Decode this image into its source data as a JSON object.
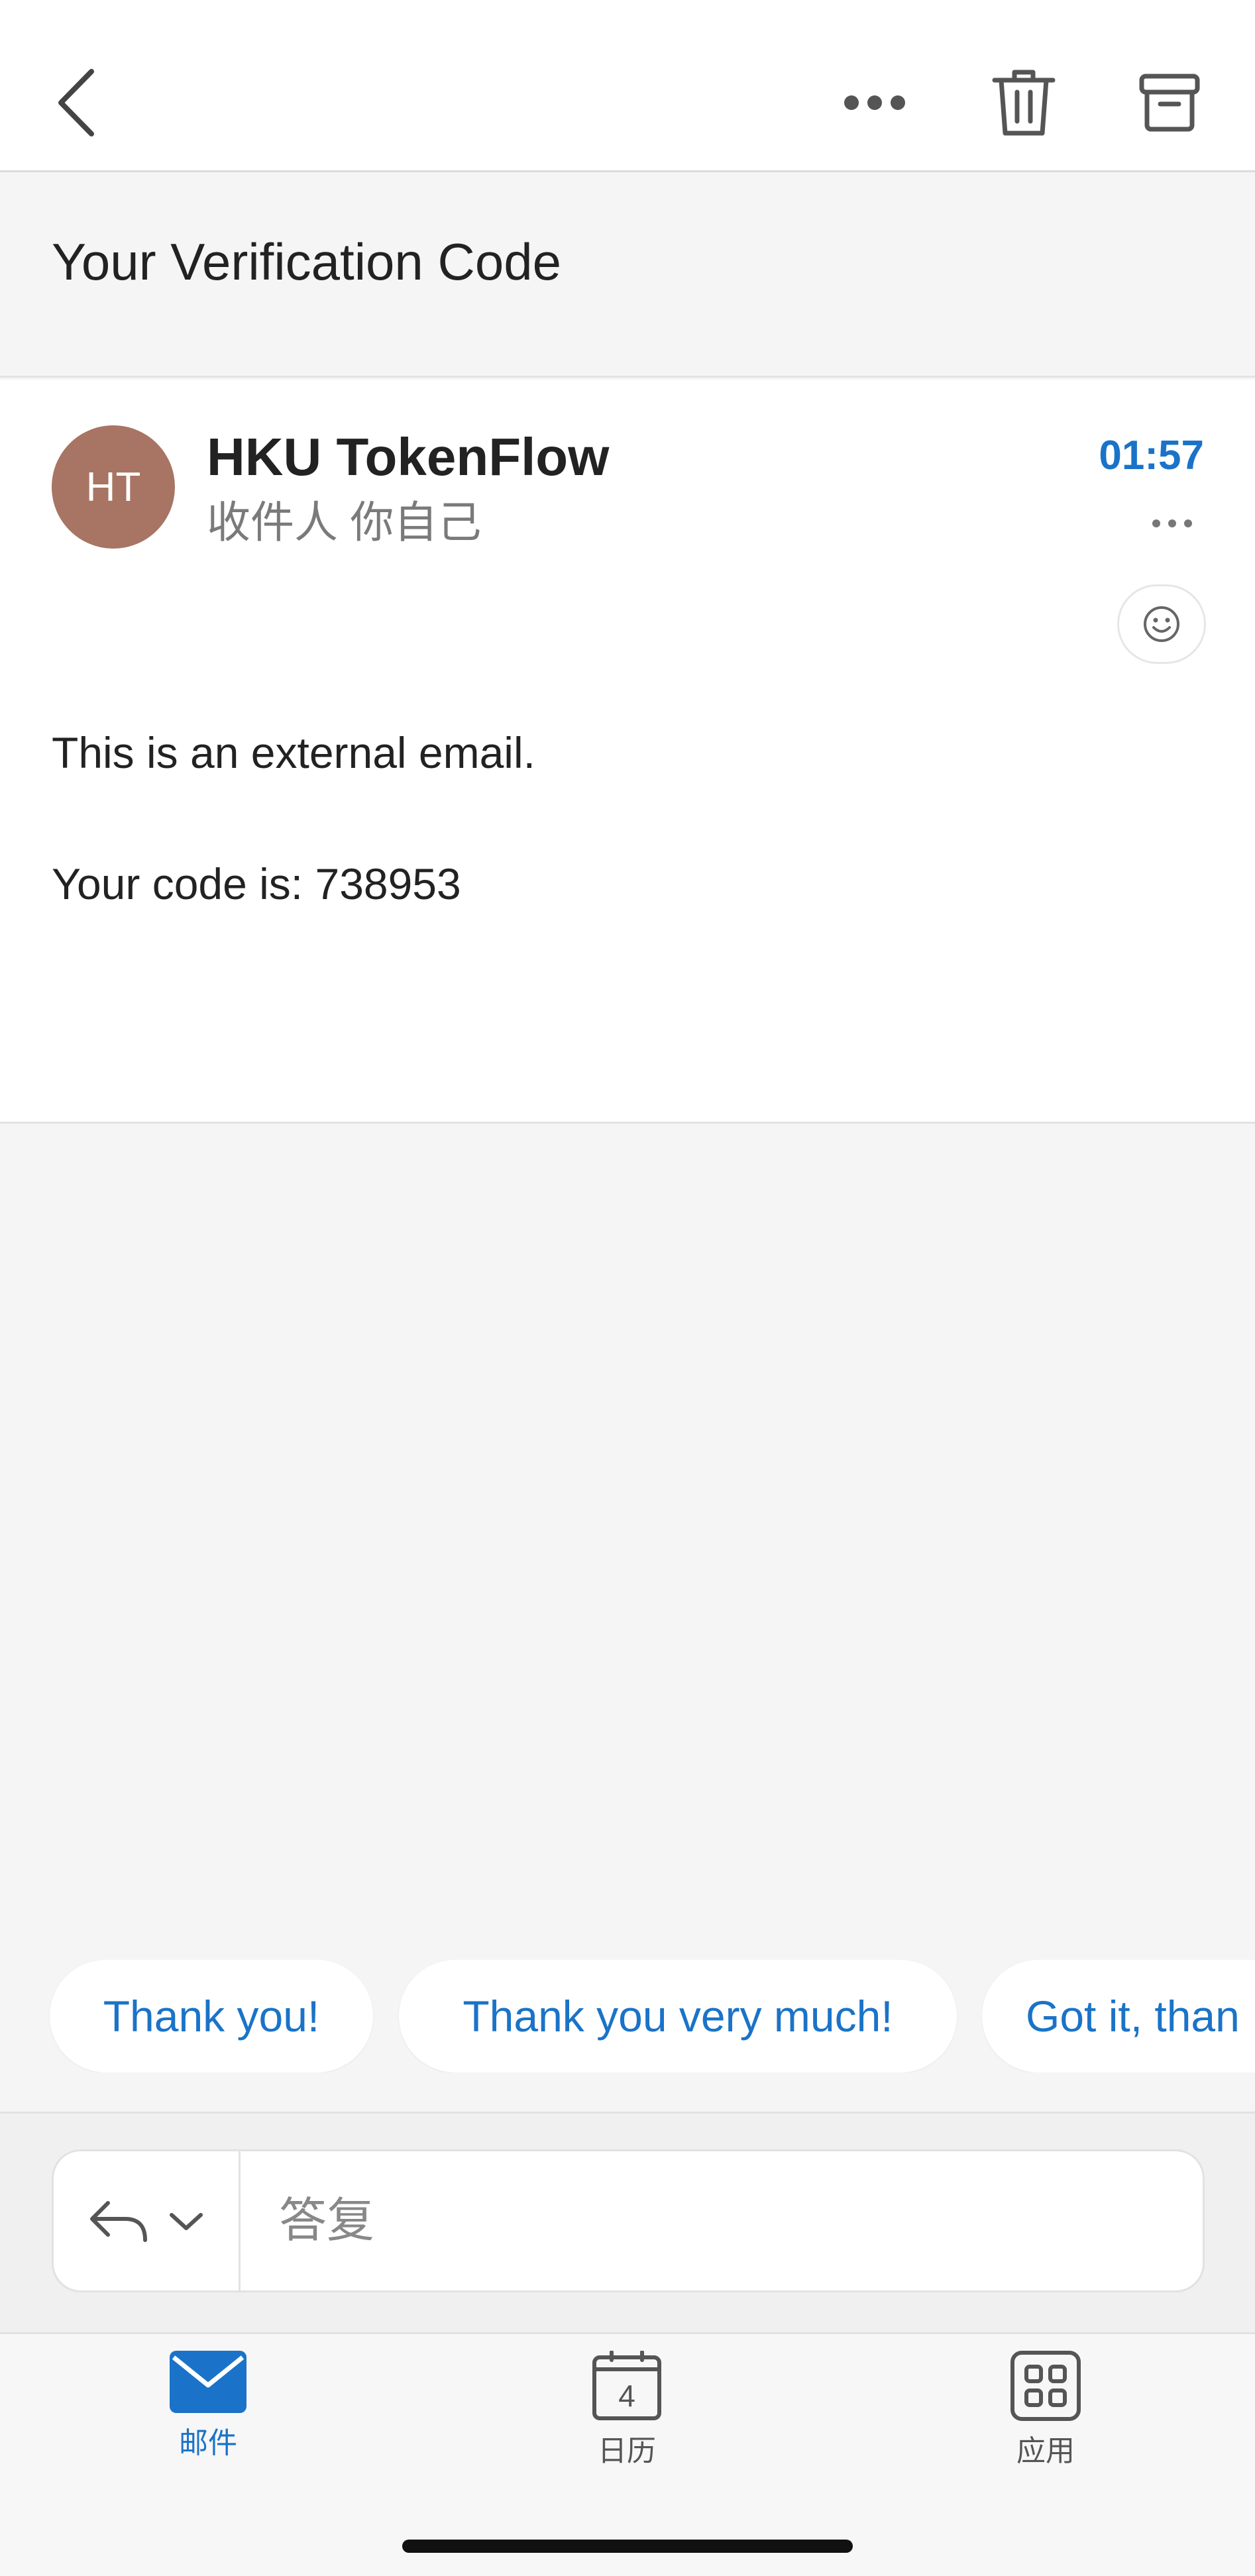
{
  "header": {
    "back_icon": "chevron-left-icon",
    "more_icon": "more-horizontal-icon",
    "delete_icon": "trash-icon",
    "archive_icon": "archive-icon"
  },
  "email": {
    "subject": "Your Verification Code",
    "sender": {
      "initials": "HT",
      "name": "HKU TokenFlow",
      "avatar_color": "#a87463"
    },
    "recipients": "收件人 你自己",
    "time": "01:57",
    "body": [
      "This is an external email.",
      "Your code is: 738953"
    ],
    "more_icon": "more-horizontal-icon",
    "reaction_icon": "smiley-icon"
  },
  "quick_replies": [
    "Thank you!",
    "Thank you very much!",
    "Got it, than"
  ],
  "reply": {
    "mode_icon": "reply-icon",
    "dropdown_icon": "chevron-down-icon",
    "placeholder": "答复"
  },
  "tabs": [
    {
      "label": "邮件",
      "icon": "mail-icon",
      "active": true
    },
    {
      "label": "日历",
      "icon": "calendar-icon",
      "badge": "4",
      "active": false
    },
    {
      "label": "应用",
      "icon": "apps-icon",
      "active": false
    }
  ],
  "colors": {
    "accent": "#1a73c8",
    "background": "#f5f5f5",
    "card": "#ffffff"
  }
}
